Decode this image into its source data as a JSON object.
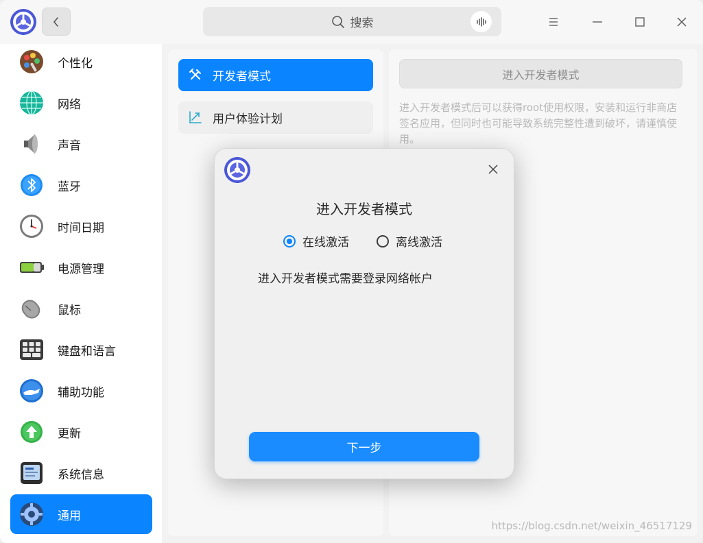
{
  "search": {
    "placeholder": "搜索"
  },
  "sidebar": {
    "items": [
      {
        "label": "个性化",
        "icon": "palette-icon"
      },
      {
        "label": "网络",
        "icon": "network-globe-icon"
      },
      {
        "label": "声音",
        "icon": "speaker-icon"
      },
      {
        "label": "蓝牙",
        "icon": "bluetooth-icon"
      },
      {
        "label": "时间日期",
        "icon": "clock-icon"
      },
      {
        "label": "电源管理",
        "icon": "battery-icon"
      },
      {
        "label": "鼠标",
        "icon": "mouse-icon"
      },
      {
        "label": "键盘和语言",
        "icon": "keyboard-icon"
      },
      {
        "label": "辅助功能",
        "icon": "accessibility-hand-icon"
      },
      {
        "label": "更新",
        "icon": "update-arrow-icon"
      },
      {
        "label": "系统信息",
        "icon": "system-info-icon"
      },
      {
        "label": "通用",
        "icon": "general-gear-icon"
      }
    ],
    "active_index": 11
  },
  "middle": {
    "items": [
      {
        "label": "开发者模式",
        "icon": "tools-icon"
      },
      {
        "label": "用户体验计划",
        "icon": "chart-arrow-icon"
      }
    ]
  },
  "right": {
    "enter_button": "进入开发者模式",
    "description": "进入开发者模式后可以获得root使用权限，安装和运行非商店签名应用，但同时也可能导致系统完整性遭到破坏，请谨慎使用。",
    "watermark": "https://blog.csdn.net/weixin_46517129"
  },
  "dialog": {
    "title": "进入开发者模式",
    "option_online": "在线激活",
    "option_offline": "离线激活",
    "selected_option": "online",
    "message": "进入开发者模式需要登录网络帐户",
    "next_button": "下一步"
  },
  "colors": {
    "accent": "#0a84ff",
    "window_bg": "#f2f2f2",
    "sidebar_bg": "#ffffff",
    "disabled_text": "#b9b9b9"
  }
}
